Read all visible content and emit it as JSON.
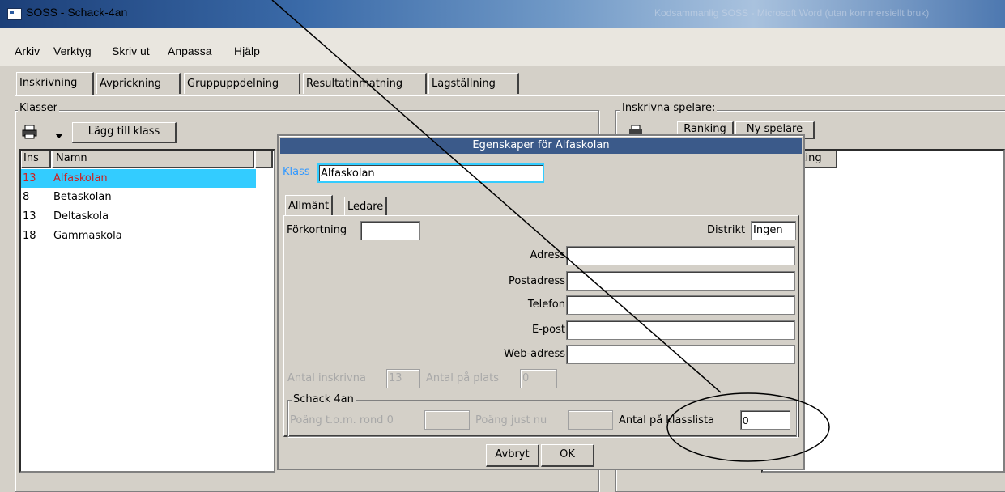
{
  "window": {
    "title": "SOSS - Schack-4an",
    "ghost_title": "Kodsammanlig SOSS - Microsoft Word (utan kommersiellt bruk)"
  },
  "menu": [
    "Arkiv",
    "Verktyg",
    "Skriv ut",
    "Anpassa",
    "Hjälp"
  ],
  "tabs": [
    "Inskrivning",
    "Avprickning",
    "Gruppuppdelning",
    "Resultatinmatning",
    "Lagställning"
  ],
  "left_panel": {
    "group_label": "Klasser",
    "add_button": "Lägg till klass",
    "columns": [
      "Ins",
      "Namn"
    ],
    "rows": [
      {
        "ins": "13",
        "name": "Alfaskolan"
      },
      {
        "ins": "8",
        "name": "Betaskolan"
      },
      {
        "ins": "13",
        "name": "Deltaskola"
      },
      {
        "ins": "18",
        "name": "Gammaskola"
      }
    ]
  },
  "right_panel": {
    "group_label": "Inskrivna spelare:",
    "ranking_button": "Ranking",
    "new_player_button": "Ny spelare",
    "column_partial": "king"
  },
  "dialog": {
    "title": "Egenskaper för Alfaskolan",
    "klass_label": "Klass",
    "klass_value": "Alfaskolan",
    "tabs": [
      "Allmänt",
      "Ledare"
    ],
    "forkortning_label": "Förkortning",
    "forkortning_value": "",
    "distrikt_label": "Distrikt",
    "distrikt_value": "Ingen",
    "fields": [
      {
        "label": "Adress",
        "value": ""
      },
      {
        "label": "Postadress",
        "value": ""
      },
      {
        "label": "Telefon",
        "value": ""
      },
      {
        "label": "E-post",
        "value": ""
      },
      {
        "label": "Web-adress",
        "value": ""
      }
    ],
    "antal_inskrivna_label": "Antal inskrivna",
    "antal_inskrivna_value": "13",
    "antal_pa_plats_label": "Antal på plats",
    "antal_pa_plats_value": "0",
    "schack_group": "Schack 4an",
    "poang_tom_label": "Poäng t.o.m. rond 0",
    "poang_just_label": "Poäng just nu",
    "antal_klasslista_label": "Antal på klasslista",
    "antal_klasslista_value": "0",
    "cancel_button": "Avbryt",
    "ok_button": "OK"
  }
}
